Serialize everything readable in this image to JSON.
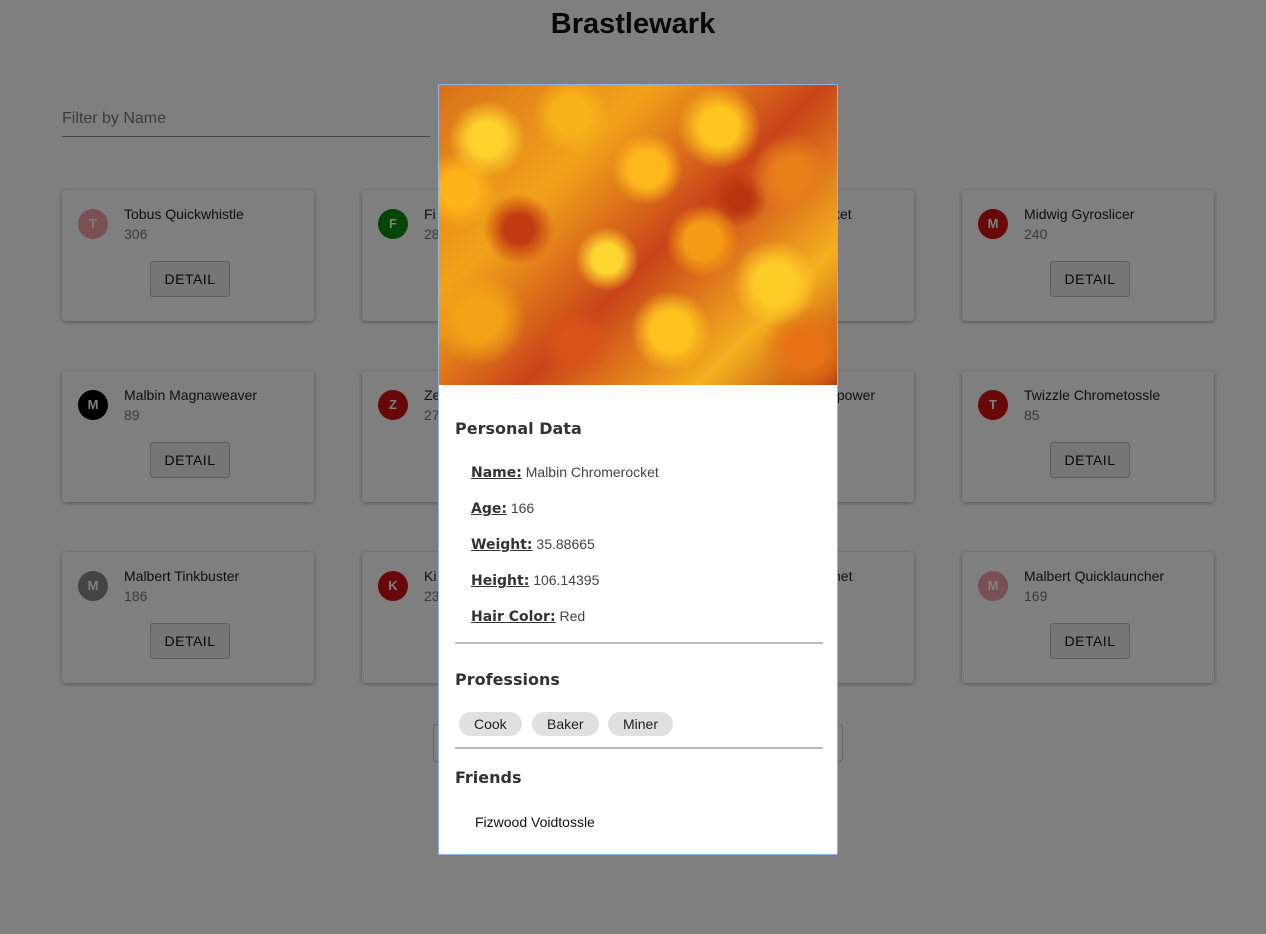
{
  "page": {
    "title": "Brastlewark"
  },
  "filter": {
    "placeholder": "Filter by Name"
  },
  "detail_label": "DETAIL",
  "cards": [
    {
      "initial": "T",
      "name": "Tobus Quickwhistle",
      "value": "306",
      "color": "#f4a0a8"
    },
    {
      "initial": "F",
      "name": "Fi",
      "value": "28",
      "color": "#0a8a0a"
    },
    {
      "initial": "",
      "name": "cket",
      "value": "",
      "color": ""
    },
    {
      "initial": "M",
      "name": "Midwig Gyroslicer",
      "value": "240",
      "color": "#d01010"
    },
    {
      "initial": "M",
      "name": "Malbin Magnaweaver",
      "value": "89",
      "color": "#000000"
    },
    {
      "initial": "Z",
      "name": "Ze",
      "value": "27",
      "color": "#d01010"
    },
    {
      "initial": "",
      "name": "alpower",
      "value": "",
      "color": ""
    },
    {
      "initial": "T",
      "name": "Twizzle Chrometossle",
      "value": "85",
      "color": "#d01010"
    },
    {
      "initial": "M",
      "name": "Malbert Tinkbuster",
      "value": "186",
      "color": "#888888"
    },
    {
      "initial": "K",
      "name": "Ki",
      "value": "23",
      "color": "#d01010"
    },
    {
      "initial": "",
      "name": "chet",
      "value": "",
      "color": ""
    },
    {
      "initial": "M",
      "name": "Malbert Quicklauncher",
      "value": "169",
      "color": "#f4a0a8"
    }
  ],
  "modal": {
    "personal_title": "Personal Data",
    "fields": [
      {
        "key": "Name:",
        "value": "Malbin Chromerocket"
      },
      {
        "key": "Age:",
        "value": "166"
      },
      {
        "key": "Weight:",
        "value": "35.88665"
      },
      {
        "key": "Height:",
        "value": "106.14395"
      },
      {
        "key": "Hair Color:",
        "value": "Red"
      }
    ],
    "professions_title": "Professions",
    "professions": [
      "Cook",
      "Baker",
      "Miner"
    ],
    "friends_title": "Friends",
    "friends": [
      "Fizwood Voidtossle"
    ]
  }
}
